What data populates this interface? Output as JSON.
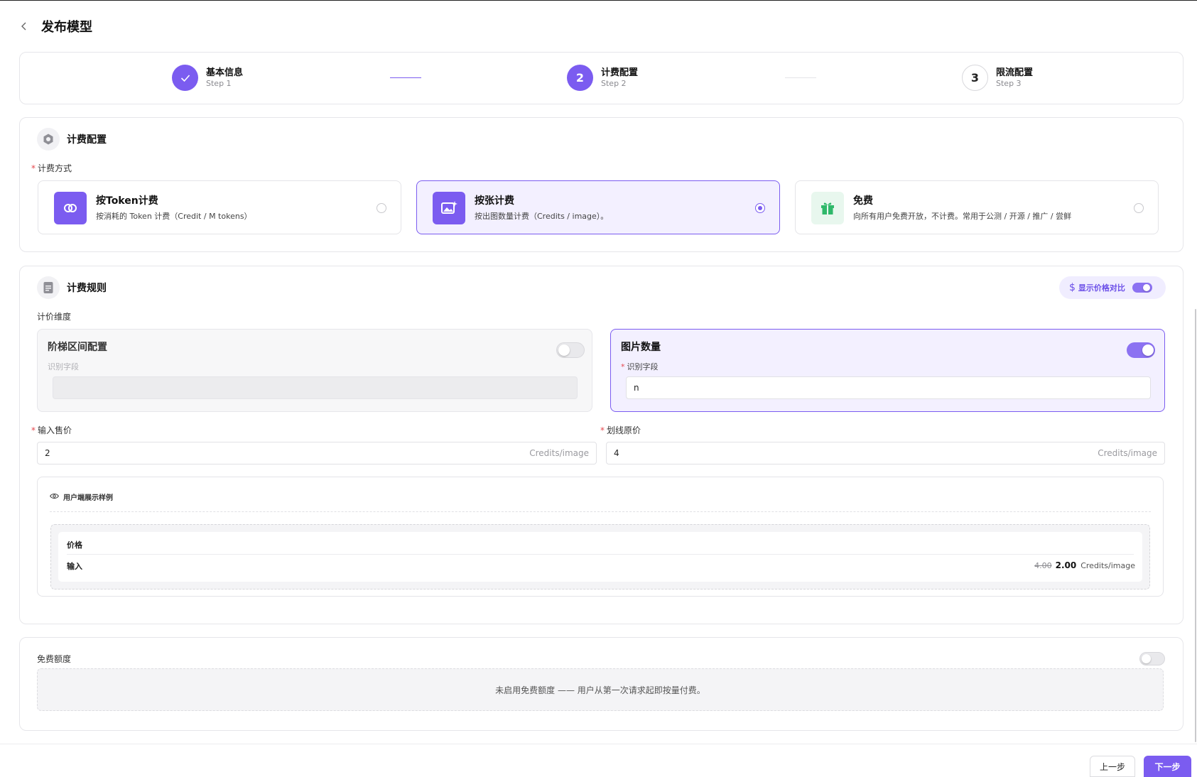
{
  "page": {
    "title": "发布模型"
  },
  "steps": [
    {
      "title": "基本信息",
      "sub": "Step 1",
      "state": "done",
      "number": "1"
    },
    {
      "title": "计费配置",
      "sub": "Step 2",
      "state": "active",
      "number": "2"
    },
    {
      "title": "限流配置",
      "sub": "Step 3",
      "state": "todo",
      "number": "3"
    }
  ],
  "billing": {
    "section_title": "计费配置",
    "method_label": "计费方式",
    "options": [
      {
        "name": "按Token计费",
        "desc": "按消耗的 Token 计费（Credit / M tokens）",
        "selected": false,
        "icon": "token-link-icon"
      },
      {
        "name": "按张计费",
        "desc": "按出图数量计费（Credits / image）。",
        "selected": true,
        "icon": "image-sparkle-icon"
      },
      {
        "name": "免费",
        "desc": "向所有用户免费开放，不计费。常用于公测 / 开源 / 推广 / 尝鲜",
        "selected": false,
        "icon": "gift-icon"
      }
    ]
  },
  "rules": {
    "section_title": "计费规则",
    "compare_label": "显示价格对比",
    "compare_on": true,
    "dimension_label": "计价维度",
    "tier": {
      "title": "阶梯区间配置",
      "field_label": "识别字段",
      "value": "",
      "enabled": false
    },
    "image_count": {
      "title": "图片数量",
      "field_label": "识别字段",
      "value": "n",
      "enabled": true
    },
    "input_price": {
      "label": "输入售价",
      "value": "2",
      "unit": "Credits/image"
    },
    "original_price": {
      "label": "划线原价",
      "value": "4",
      "unit": "Credits/image"
    },
    "preview": {
      "title": "用户端展示样例",
      "header": "价格",
      "row_label": "输入",
      "old_price": "4.00",
      "new_price": "2.00",
      "unit": "Credits/image"
    }
  },
  "free_quota": {
    "label": "免费额度",
    "enabled": false,
    "empty_text": "未启用免费额度 —— 用户从第一次请求起即按量付费。"
  },
  "footer": {
    "prev_label": "上一步",
    "next_label": "下一步"
  },
  "colors": {
    "accent": "#7b5cf0",
    "accent_soft": "#f3f0ff",
    "free_green": "#2fb86a"
  }
}
